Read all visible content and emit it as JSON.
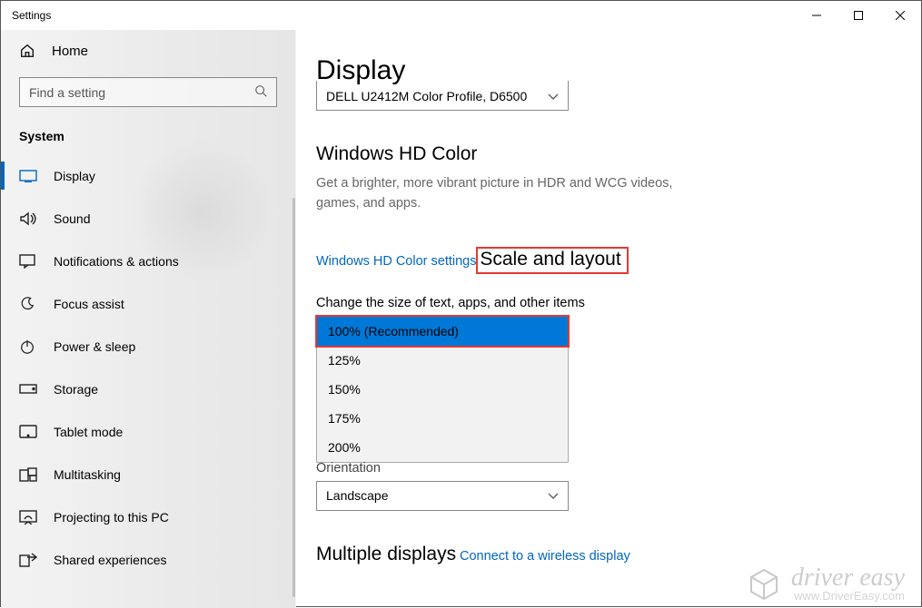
{
  "window": {
    "title": "Settings"
  },
  "sidebar": {
    "home_label": "Home",
    "search_placeholder": "Find a setting",
    "category": "System",
    "items": [
      {
        "label": "Display",
        "icon": "display-icon",
        "active": true
      },
      {
        "label": "Sound",
        "icon": "sound-icon"
      },
      {
        "label": "Notifications & actions",
        "icon": "notifications-icon"
      },
      {
        "label": "Focus assist",
        "icon": "focus-assist-icon"
      },
      {
        "label": "Power & sleep",
        "icon": "power-icon"
      },
      {
        "label": "Storage",
        "icon": "storage-icon"
      },
      {
        "label": "Tablet mode",
        "icon": "tablet-icon"
      },
      {
        "label": "Multitasking",
        "icon": "multitasking-icon"
      },
      {
        "label": "Projecting to this PC",
        "icon": "projecting-icon"
      },
      {
        "label": "Shared experiences",
        "icon": "shared-icon"
      }
    ]
  },
  "main": {
    "heading": "Display",
    "color_profile_selected": "DELL U2412M Color Profile, D6500",
    "hdcolor": {
      "heading": "Windows HD Color",
      "desc": "Get a brighter, more vibrant picture in HDR and WCG videos, games, and apps.",
      "link": "Windows HD Color settings"
    },
    "scale": {
      "heading": "Scale and layout",
      "label": "Change the size of text, apps, and other items",
      "options": [
        "100% (Recommended)",
        "125%",
        "150%",
        "175%",
        "200%"
      ],
      "selected_index": 0
    },
    "orientation": {
      "partial_label": "Orientation",
      "selected": "Landscape"
    },
    "multiple": {
      "heading": "Multiple displays",
      "link": "Connect to a wireless display"
    }
  },
  "watermark": {
    "brand": "driver easy",
    "url": "www.DriverEasy.com"
  }
}
